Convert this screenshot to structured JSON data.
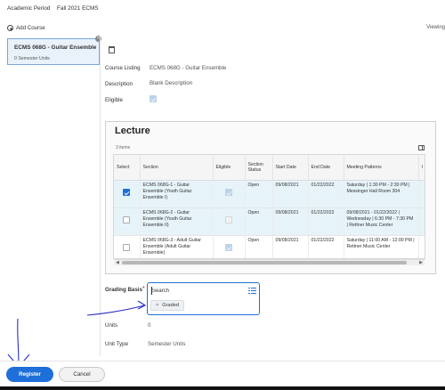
{
  "header": {
    "academic_period_label": "Academic Period",
    "academic_period_value": "Fall 2021 ECMS"
  },
  "toolbar": {
    "add_course_label": "Add Course",
    "viewing_label": "Viewing"
  },
  "course_card": {
    "title": "ECMS 068G - Guitar Ensemble",
    "units": "0 Semester Units"
  },
  "details": {
    "course_listing_label": "Course Listing",
    "course_listing_value": "ECMS 068G - Guitar Ensemble",
    "description_label": "Description",
    "description_value": "Blank Description",
    "eligible_label": "Eligible",
    "eligible_checked": true
  },
  "lecture": {
    "title": "Lecture",
    "items_count": "3 items",
    "columns": [
      "Select",
      "Section",
      "Eligible",
      "Section Status",
      "Start Date",
      "End Date",
      "Meeting Patterns",
      "I"
    ],
    "rows": [
      {
        "selected": true,
        "section": "ECMS 068G-1 - Guitar Ensemble (Youth Guitar Ensemble I)",
        "eligible": true,
        "status": "Open",
        "start": "09/08/2021",
        "end": "01/22/2022",
        "meeting": "Saturday | 1:30 PM - 2:30 PM | Messinger Hall Room 304"
      },
      {
        "selected": false,
        "section": "ECMS 068G-2 - Guitar Ensemble (Youth Guitar Ensemble II)",
        "eligible": false,
        "status": "Open",
        "start": "09/08/2021",
        "end": "01/22/2022",
        "meeting": "09/08/2021 - 01/22/2022 | Wednesday | 6:30 PM - 7:30 PM | Rettner Music Center"
      },
      {
        "selected": false,
        "section": "ECMS 068G-3 - Adult Guitar Ensemble (Adult Guitar Ensemble)",
        "eligible": true,
        "status": "Open",
        "start": "09/08/2021",
        "end": "01/22/2022",
        "meeting": "Saturday | 11:00 AM - 12:00 PM | Rettner Music Center"
      }
    ]
  },
  "grading": {
    "label": "Grading Basis",
    "required_mark": "*",
    "search_placeholder": "Search",
    "selected_pill": "Graded",
    "pill_remove": "×"
  },
  "units": {
    "label": "Units",
    "value": "0"
  },
  "unit_type": {
    "label": "Unit Type",
    "value": "Semester Units"
  },
  "actions": {
    "register_label": "Register",
    "cancel_label": "Cancel"
  },
  "colors": {
    "accent": "#1e6fd9",
    "selected_row": "#e6f4fa",
    "required": "#d0021b",
    "annotation": "#2b2fc4"
  },
  "icons": [
    "add-circle-icon",
    "close-icon",
    "calendar-icon",
    "checkbox-icon",
    "grid-view-icon",
    "list-prompt-icon",
    "remove-pill-icon"
  ]
}
